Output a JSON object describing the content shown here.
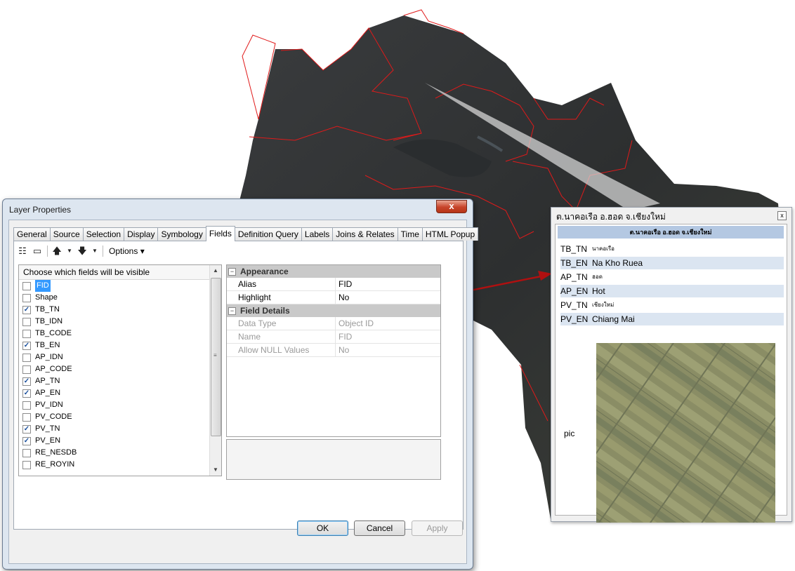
{
  "dialog": {
    "title": "Layer Properties",
    "close_glyph": "x",
    "tabs": [
      "General",
      "Source",
      "Selection",
      "Display",
      "Symbology",
      "Fields",
      "Definition Query",
      "Labels",
      "Joins & Relates",
      "Time",
      "HTML Popup"
    ],
    "active_tab": "Fields",
    "toolbar": {
      "options_label": "Options ▾"
    },
    "field_list": {
      "header": "Choose which fields will be visible",
      "items": [
        {
          "name": "FID",
          "checked": false,
          "selected": true
        },
        {
          "name": "Shape",
          "checked": false,
          "selected": false
        },
        {
          "name": "TB_TN",
          "checked": true,
          "selected": false
        },
        {
          "name": "TB_IDN",
          "checked": false,
          "selected": false
        },
        {
          "name": "TB_CODE",
          "checked": false,
          "selected": false
        },
        {
          "name": "TB_EN",
          "checked": true,
          "selected": false
        },
        {
          "name": "AP_IDN",
          "checked": false,
          "selected": false
        },
        {
          "name": "AP_CODE",
          "checked": false,
          "selected": false
        },
        {
          "name": "AP_TN",
          "checked": true,
          "selected": false
        },
        {
          "name": "AP_EN",
          "checked": true,
          "selected": false
        },
        {
          "name": "PV_IDN",
          "checked": false,
          "selected": false
        },
        {
          "name": "PV_CODE",
          "checked": false,
          "selected": false
        },
        {
          "name": "PV_TN",
          "checked": true,
          "selected": false
        },
        {
          "name": "PV_EN",
          "checked": true,
          "selected": false
        },
        {
          "name": "RE_NESDB",
          "checked": false,
          "selected": false
        },
        {
          "name": "RE_ROYIN",
          "checked": false,
          "selected": false
        }
      ]
    },
    "properties": {
      "appearance_label": "Appearance",
      "alias_key": "Alias",
      "alias_value": "FID",
      "highlight_key": "Highlight",
      "highlight_value": "No",
      "details_label": "Field Details",
      "datatype_key": "Data Type",
      "datatype_value": "Object ID",
      "name_key": "Name",
      "name_value": "FID",
      "nulls_key": "Allow NULL Values",
      "nulls_value": "No"
    },
    "buttons": {
      "ok": "OK",
      "cancel": "Cancel",
      "apply": "Apply"
    }
  },
  "popup": {
    "title": "ต.นาคอเรือ อ.ฮอด จ.เชียงใหม่",
    "close_glyph": "x",
    "header": "ต.นาคอเรือ อ.ฮอด จ.เชียงใหม่",
    "rows": [
      {
        "key": "TB_TN",
        "value": "นาคอเรือ"
      },
      {
        "key": "TB_EN",
        "value": "Na Kho Ruea"
      },
      {
        "key": "AP_TN",
        "value": "ฮอด"
      },
      {
        "key": "AP_EN",
        "value": "Hot"
      },
      {
        "key": "PV_TN",
        "value": "เชียงใหม่"
      },
      {
        "key": "PV_EN",
        "value": "Chiang Mai"
      }
    ],
    "pic_label": "pic"
  },
  "colors": {
    "boundary": "#e01a1a",
    "arrow": "#b01010",
    "header_blue": "#b4c8e2",
    "selection": "#3399ff"
  }
}
